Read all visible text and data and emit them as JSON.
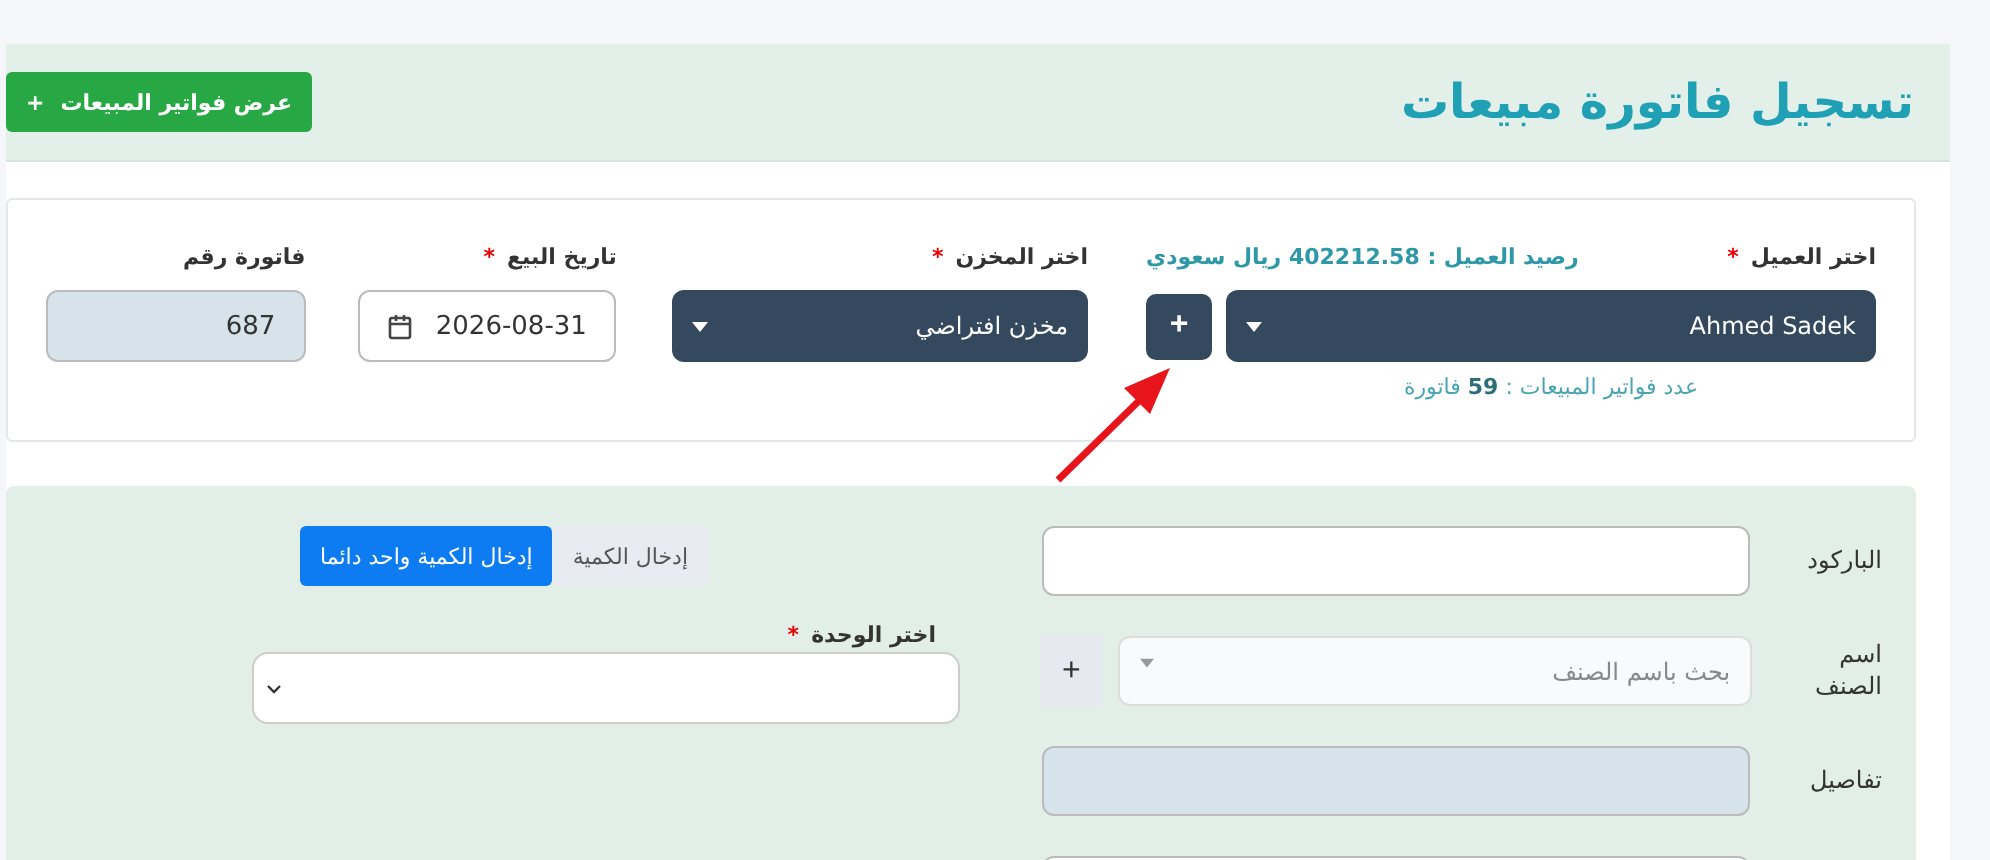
{
  "header": {
    "title": "تسجيل فاتورة مبيعات",
    "button": {
      "label": "عرض فواتير المبيعات",
      "icon": "+"
    }
  },
  "required_mark": "*",
  "invoice": {
    "customer": {
      "label": "اختر العميل",
      "required": true,
      "value": "Ahmed Sadek",
      "balance": "رصيد العميل : 402212.58 ريال سعودي",
      "add": "+",
      "count": "عدد فواتير المبيعات : **59** فاتورة"
    },
    "store": {
      "label": "اختر المخزن",
      "required": true,
      "value": "مخزن افتراضي"
    },
    "date": {
      "label": "تاريخ البيع",
      "required": true,
      "value": "2026-08-31"
    },
    "number": {
      "label": "فاتورة رقم",
      "required": false,
      "value": "687"
    }
  },
  "item": {
    "barcode": {
      "label": "الباركود"
    },
    "name": {
      "label": "اسم الصنف",
      "placeholder": "بحث باسم الصنف",
      "add": "+"
    },
    "details": {
      "label": "تفاصيل"
    },
    "quantity_modes": [
      {
        "label": "إدخال الكمية",
        "selected": false
      },
      {
        "label": "إدخال الكمية واحد دائما",
        "selected": true
      }
    ],
    "unit": {
      "label": "اختر الوحدة",
      "required": true
    }
  }
}
